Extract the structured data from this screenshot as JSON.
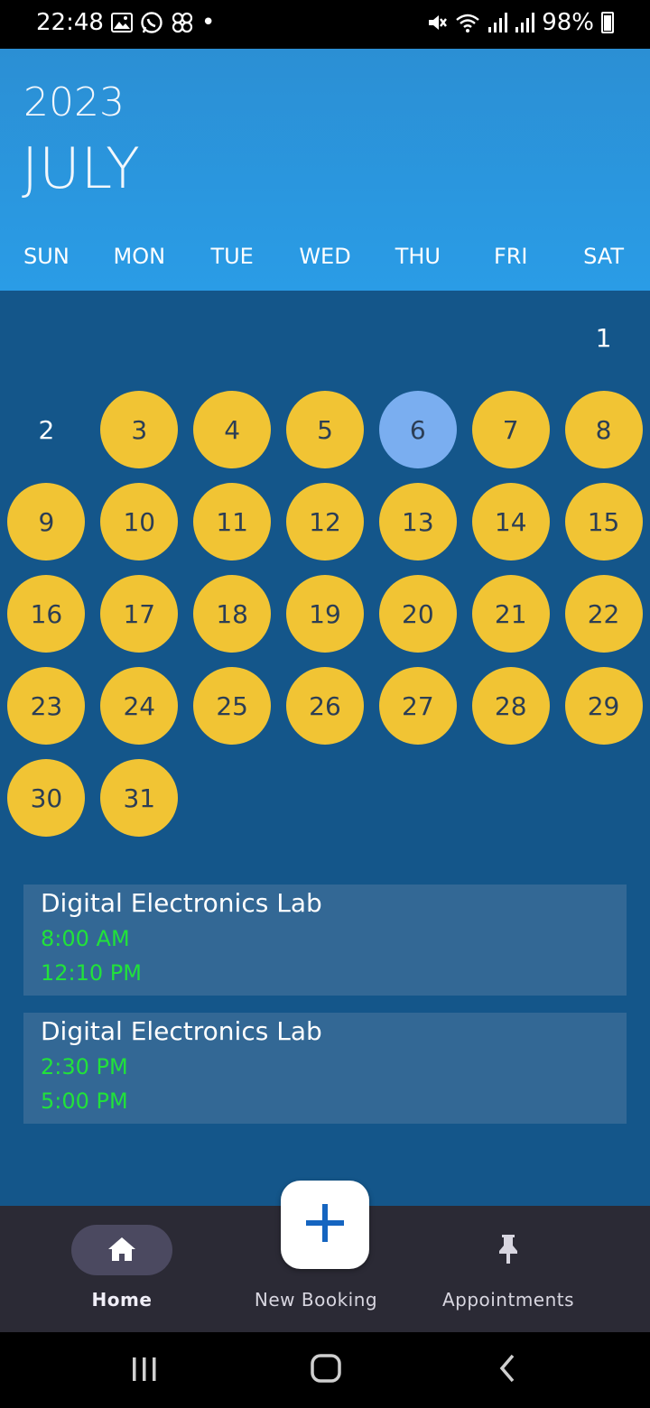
{
  "status_bar": {
    "time": "22:48",
    "battery": "98%",
    "dot": "•",
    "icons_left": [
      "image-icon",
      "whatsapp-icon",
      "app-icon"
    ],
    "icons_right": [
      "mute-icon",
      "wifi-icon",
      "signal-icon",
      "signal-icon",
      "battery-icon"
    ]
  },
  "header": {
    "year": "2023",
    "month": "JULY",
    "weekdays": [
      "SUN",
      "MON",
      "TUE",
      "WED",
      "THU",
      "FRI",
      "SAT"
    ]
  },
  "calendar": {
    "days": [
      {
        "label": "1",
        "status": "plain"
      },
      {
        "label": "2",
        "status": "plain"
      },
      {
        "label": "3",
        "status": "booked"
      },
      {
        "label": "4",
        "status": "booked"
      },
      {
        "label": "5",
        "status": "booked"
      },
      {
        "label": "6",
        "status": "today"
      },
      {
        "label": "7",
        "status": "booked"
      },
      {
        "label": "8",
        "status": "booked"
      },
      {
        "label": "9",
        "status": "booked"
      },
      {
        "label": "10",
        "status": "booked"
      },
      {
        "label": "11",
        "status": "booked"
      },
      {
        "label": "12",
        "status": "booked"
      },
      {
        "label": "13",
        "status": "booked"
      },
      {
        "label": "14",
        "status": "booked"
      },
      {
        "label": "15",
        "status": "booked"
      },
      {
        "label": "16",
        "status": "booked"
      },
      {
        "label": "17",
        "status": "booked"
      },
      {
        "label": "18",
        "status": "booked"
      },
      {
        "label": "19",
        "status": "booked"
      },
      {
        "label": "20",
        "status": "booked"
      },
      {
        "label": "21",
        "status": "booked"
      },
      {
        "label": "22",
        "status": "booked"
      },
      {
        "label": "23",
        "status": "booked"
      },
      {
        "label": "24",
        "status": "booked"
      },
      {
        "label": "25",
        "status": "booked"
      },
      {
        "label": "26",
        "status": "booked"
      },
      {
        "label": "27",
        "status": "booked"
      },
      {
        "label": "28",
        "status": "booked"
      },
      {
        "label": "29",
        "status": "booked"
      },
      {
        "label": "30",
        "status": "booked"
      },
      {
        "label": "31",
        "status": "booked"
      }
    ],
    "colors": {
      "booked": "#f1c434",
      "today": "#7aaef0",
      "background": "#14568a"
    }
  },
  "events": [
    {
      "title": "Digital Electronics Lab",
      "start": "8:00 AM",
      "end": "12:10 PM"
    },
    {
      "title": "Digital Electronics Lab",
      "start": "2:30 PM",
      "end": "5:00 PM"
    }
  ],
  "bottom_nav": {
    "home_label": "Home",
    "new_booking_label": "New Booking",
    "appointments_label": "Appointments",
    "fab_icon": "plus-icon"
  },
  "system_nav": [
    "recents-icon",
    "home-circle-icon",
    "back-icon"
  ]
}
